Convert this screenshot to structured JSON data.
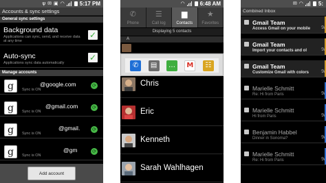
{
  "status": {
    "time1": "5:17 PM",
    "time2": "6:48 AM",
    "time3": "5:"
  },
  "accounts_screen": {
    "title": "Accounts & sync settings",
    "general_header": "General sync settings",
    "background_data": {
      "title": "Background data",
      "desc": "Applications can sync, send, and receive data at any time",
      "checked": true
    },
    "auto_sync": {
      "title": "Auto-sync",
      "desc": "Applications sync data automatically",
      "checked": true
    },
    "manage_header": "Manage accounts",
    "accounts": [
      {
        "email": "@google.com",
        "status": "Sync is ON"
      },
      {
        "email": "@gmail.com",
        "status": "Sync is ON"
      },
      {
        "email": "@gmail.",
        "status": "Sync is ON"
      },
      {
        "email": "@gm",
        "status": "Sync is ON"
      }
    ],
    "add_account": "Add account",
    "account_icon_letter": "g"
  },
  "contacts_screen": {
    "tabs": [
      {
        "label": "Phone",
        "icon": "phone-icon",
        "glyph": "✆"
      },
      {
        "label": "Call log",
        "icon": "call-log-icon",
        "glyph": "☰"
      },
      {
        "label": "Contacts",
        "icon": "contacts-icon",
        "glyph": "▆"
      },
      {
        "label": "Favorites",
        "icon": "star-icon",
        "glyph": "★"
      }
    ],
    "info": "Displaying 5 contacts",
    "letter": "A",
    "contacts": [
      {
        "name": "Chris"
      },
      {
        "name": "Eric"
      },
      {
        "name": "Kenneth"
      },
      {
        "name": "Sarah Wahlhagen"
      }
    ],
    "quick_contact_actions": [
      {
        "icon": "phone-call-icon",
        "glyph": "✆",
        "color": "#1f6fd6"
      },
      {
        "icon": "contact-card-icon",
        "glyph": "▤",
        "color": "#6c6c6c"
      },
      {
        "icon": "sms-icon",
        "glyph": "…",
        "color": "#3fae3f"
      },
      {
        "icon": "gmail-icon",
        "glyph": "M",
        "color": "#d93025"
      },
      {
        "icon": "contacts-book-icon",
        "glyph": "☷",
        "color": "#d9a520"
      }
    ]
  },
  "inbox_screen": {
    "title": "Combined Inbox",
    "messages": [
      {
        "from": "Gmail Team",
        "subject": "Access Gmail on your mobile",
        "date": "9/",
        "unread": true,
        "bar": "#d39a2a"
      },
      {
        "from": "Gmail Team",
        "subject": "Import your contacts and ol",
        "date": "9/",
        "unread": true,
        "bar": "#d39a2a"
      },
      {
        "from": "Gmail Team",
        "subject": "Customize Gmail with colors",
        "date": "9/",
        "unread": true,
        "bar": "#d39a2a"
      },
      {
        "from": "Marielle Schmitt",
        "subject": "Re: Hi from Paris",
        "date": "9/",
        "unread": false,
        "bar": "#2f6fd0"
      },
      {
        "from": "Marielle Schmitt",
        "subject": "Hi from Paris",
        "date": "9/",
        "unread": false,
        "bar": "#2f6fd0"
      },
      {
        "from": "Benjamin Habbel",
        "subject": "Dinner in Sonoma?",
        "date": "9/",
        "unread": false,
        "bar": "#2f6fd0"
      },
      {
        "from": "Marielle Schmitt",
        "subject": "Re: Hi from Paris",
        "date": "9/",
        "unread": false,
        "bar": "#2f6fd0"
      }
    ]
  }
}
